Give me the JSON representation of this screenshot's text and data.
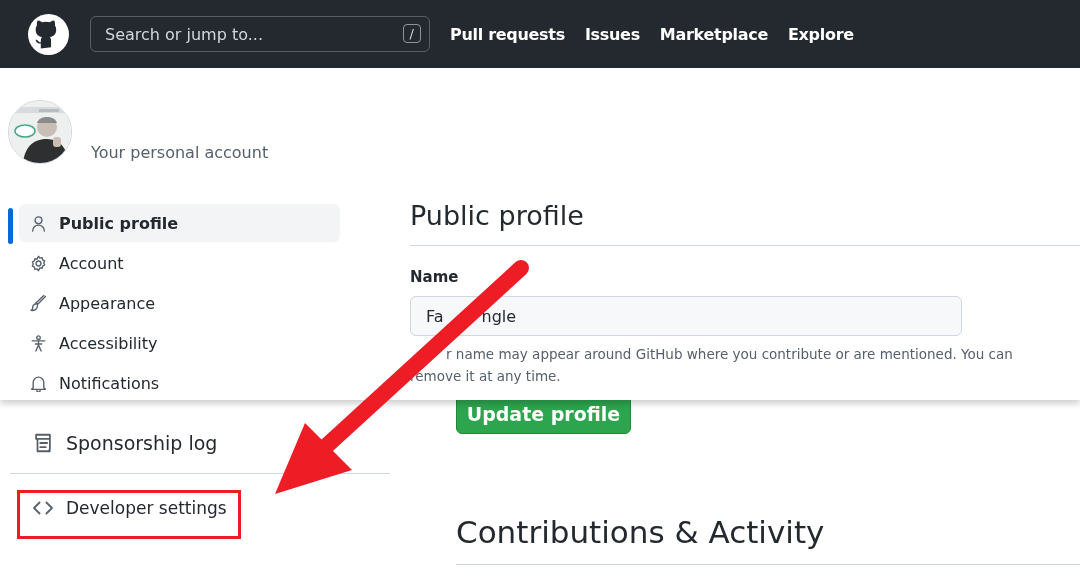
{
  "header": {
    "search": {
      "placeholder": "Search or jump to...",
      "shortcut": "/"
    },
    "nav": [
      {
        "label": "Pull requests"
      },
      {
        "label": "Issues"
      },
      {
        "label": "Marketplace"
      },
      {
        "label": "Explore"
      }
    ]
  },
  "overlay": {
    "account_label": "Your personal account",
    "sidebar": {
      "items": [
        {
          "label": "Public profile",
          "selected": true
        },
        {
          "label": "Account",
          "selected": false
        },
        {
          "label": "Appearance",
          "selected": false
        },
        {
          "label": "Accessibility",
          "selected": false
        },
        {
          "label": "Notifications",
          "selected": false
        }
      ]
    },
    "main": {
      "title": "Public profile",
      "field": {
        "label": "Name",
        "value": [
          "Fa",
          "ngle"
        ],
        "note": "r name may appear around GitHub where you contribute or are mentioned. You can remove it at any time."
      }
    }
  },
  "page": {
    "sidebar": {
      "items": [
        {
          "label": "Sponsorship log"
        }
      ],
      "footer_items": [
        {
          "label": "Developer settings"
        }
      ]
    },
    "main": {
      "button": "Update profile",
      "heading": "Contributions & Activity"
    }
  }
}
